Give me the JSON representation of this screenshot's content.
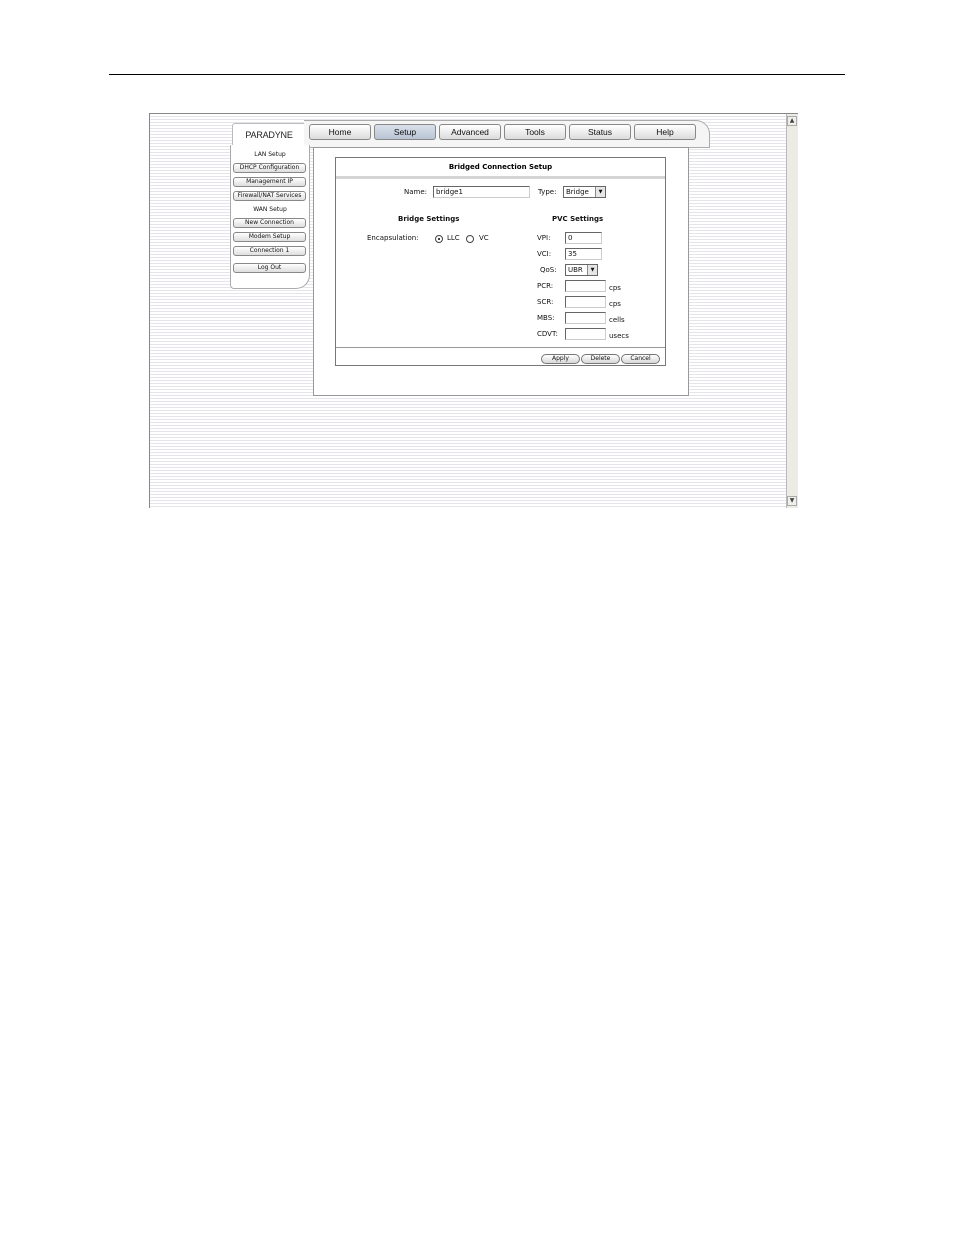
{
  "brand": {
    "logo": "PARADYNE"
  },
  "nav": {
    "tabs": [
      "Home",
      "Setup",
      "Advanced",
      "Tools",
      "Status",
      "Help"
    ],
    "active": "Setup"
  },
  "sidebar": {
    "lan_heading": "LAN Setup",
    "lan_items": [
      "DHCP Configuration",
      "Management IP",
      "Firewall/NAT Services"
    ],
    "wan_heading": "WAN Setup",
    "wan_items": [
      "New Connection",
      "Modem Setup",
      "Connection 1"
    ],
    "logout": "Log Out"
  },
  "form": {
    "title": "Bridged Connection Setup",
    "name_label": "Name:",
    "name_value": "bridge1",
    "type_label": "Type:",
    "type_value": "Bridge",
    "bridge_heading": "Bridge Settings",
    "encapsulation_label": "Encapsulation:",
    "encap_llc": "LLC",
    "encap_vc": "VC",
    "encap_selected": "LLC",
    "pvc_heading": "PVC Settings",
    "vpi_label": "VPI:",
    "vpi_value": "0",
    "vci_label": "VCI:",
    "vci_value": "35",
    "qos_label": "QoS:",
    "qos_value": "UBR",
    "pcr_label": "PCR:",
    "pcr_unit": "cps",
    "scr_label": "SCR:",
    "scr_unit": "cps",
    "mbs_label": "MBS:",
    "mbs_unit": "cells",
    "cdvt_label": "CDVT:",
    "cdvt_unit": "usecs"
  },
  "actions": {
    "apply": "Apply",
    "delete": "Delete",
    "cancel": "Cancel"
  },
  "scrollbar": {
    "up_icon": "arrow-up-icon",
    "down_icon": "arrow-down-icon"
  }
}
